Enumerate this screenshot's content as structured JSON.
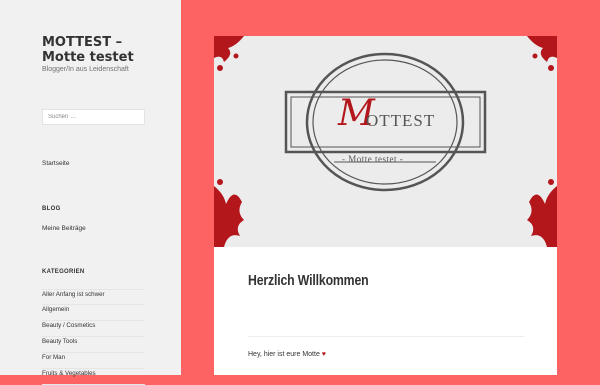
{
  "site": {
    "title": "MOTTEST – Motte testet",
    "tagline": "Blogger/In aus Leidenschaft"
  },
  "search": {
    "placeholder": "Suchen …"
  },
  "nav": {
    "home": "Startseite"
  },
  "blog_widget": {
    "heading": "BLOG",
    "link": "Meine Beiträge"
  },
  "categories": {
    "heading": "KATEGORIEN",
    "items": [
      "Aller Anfang ist schwer",
      "Allgemein",
      "Beauty / Cosmetics",
      "Beauty Tools",
      "For Man",
      "Fruits & Vegetables"
    ]
  },
  "hero": {
    "logo_initial": "M",
    "logo_word": "OTTEST",
    "logo_sub": "- Motte testet -"
  },
  "post": {
    "title": "Herzlich Willkommen",
    "text": "Hey, hier ist eure Motte",
    "heart": "♥"
  },
  "colors": {
    "background": "#fd6363",
    "sidebar": "#f1f1f1",
    "accent_red": "#b3171c"
  }
}
